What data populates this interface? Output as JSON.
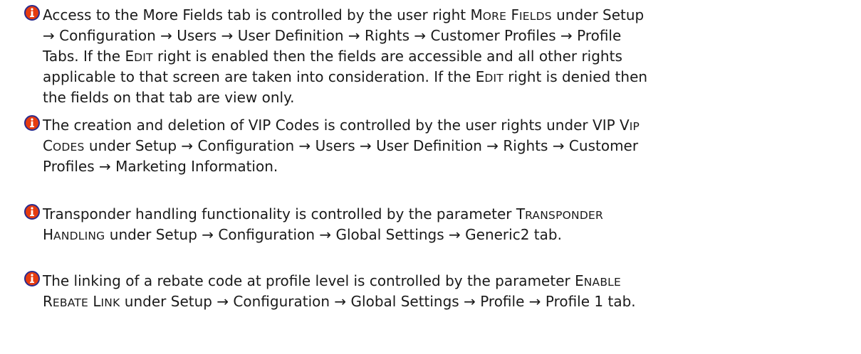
{
  "notes": [
    {
      "lines": [
        [
          "Access to the More Fields tab is controlled by the user right ",
          {
            "sc": "More Fields"
          },
          " under Setup"
        ],
        [
          "→ Configuration → Users → User Definition → Rights → Customer Profiles → Profile"
        ],
        [
          "Tabs. If the ",
          {
            "sc": "Edit"
          },
          " right is enabled then the fields are accessible and all other rights"
        ],
        [
          "applicable to that screen are taken into consideration. If the ",
          {
            "sc": "Edit"
          },
          " right is denied then"
        ],
        [
          "the fields on that tab are view only."
        ]
      ]
    },
    {
      "lines": [
        [
          "The creation and deletion of VIP Codes is controlled by the user rights under VIP ",
          {
            "sc": "VIP"
          }
        ],
        [
          {
            "sc": "Codes"
          },
          " under Setup → Configuration → Users → User Definition → Rights → Customer"
        ],
        [
          "Profiles → Marketing Information."
        ]
      ]
    },
    {
      "lines": [
        [
          "Transponder handling functionality is controlled by the parameter ",
          {
            "sc": "Transponder"
          }
        ],
        [
          {
            "sc": "Handling"
          },
          " under Setup → Configuration → Global Settings → Generic2 tab."
        ]
      ]
    },
    {
      "lines": [
        [
          "The linking of a rebate code at profile level is controlled by the parameter ",
          {
            "sc": "Enable"
          }
        ],
        [
          {
            "sc": "Rebate Link"
          },
          " under Setup → Configuration → Global Settings → Profile → Profile 1 tab."
        ]
      ]
    }
  ],
  "icon": "info-icon",
  "colors": {
    "icon_ring": "#2b2b8c",
    "icon_fill": "#e63b10",
    "icon_glyph": "#ffffff",
    "text": "#1a1a1a"
  }
}
